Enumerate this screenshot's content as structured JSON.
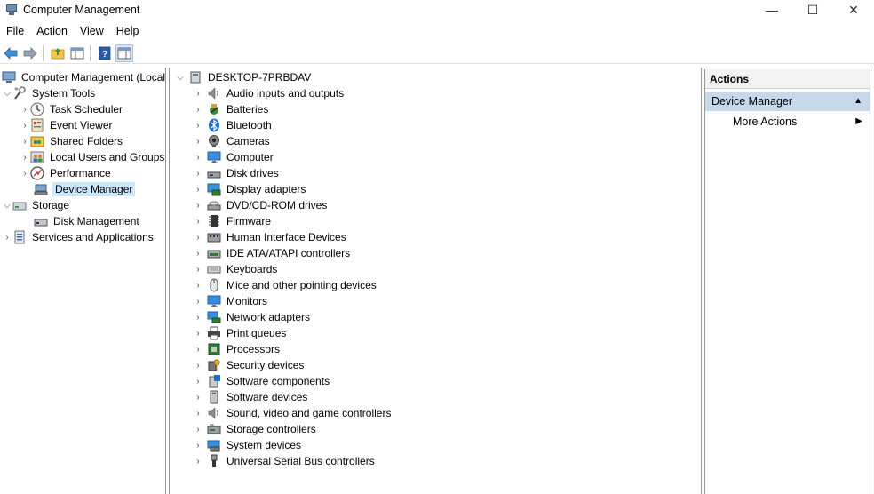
{
  "window": {
    "title": "Computer Management",
    "controls": {
      "minimize": "—",
      "maximize": "☐",
      "close": "✕"
    }
  },
  "menubar": [
    "File",
    "Action",
    "View",
    "Help"
  ],
  "toolbar": {
    "buttons": [
      "back-icon",
      "forward-icon",
      "up-folder-icon",
      "show-hide-tree-icon",
      "help-icon",
      "show-hide-action-pane-icon"
    ]
  },
  "left_tree": {
    "root": "Computer Management (Local",
    "system_tools": "System Tools",
    "items_system": [
      {
        "label": "Task Scheduler",
        "icon": "clock-icon",
        "arrow": true
      },
      {
        "label": "Event Viewer",
        "icon": "event-viewer-icon",
        "arrow": true
      },
      {
        "label": "Shared Folders",
        "icon": "shared-folder-icon",
        "arrow": true
      },
      {
        "label": "Local Users and Groups",
        "icon": "users-icon",
        "arrow": true
      },
      {
        "label": "Performance",
        "icon": "performance-icon",
        "arrow": true
      },
      {
        "label": "Device Manager",
        "icon": "device-manager-icon",
        "arrow": false,
        "selected": true
      }
    ],
    "storage": "Storage",
    "items_storage": [
      {
        "label": "Disk Management",
        "icon": "disk-management-icon"
      }
    ],
    "services": "Services and Applications"
  },
  "device_tree": {
    "root": "DESKTOP-7PRBDAV",
    "categories": [
      {
        "label": "Audio inputs and outputs",
        "icon": "speaker-icon"
      },
      {
        "label": "Batteries",
        "icon": "battery-icon"
      },
      {
        "label": "Bluetooth",
        "icon": "bluetooth-icon"
      },
      {
        "label": "Cameras",
        "icon": "camera-icon"
      },
      {
        "label": "Computer",
        "icon": "monitor-icon"
      },
      {
        "label": "Disk drives",
        "icon": "disk-drive-icon"
      },
      {
        "label": "Display adapters",
        "icon": "display-adapter-icon"
      },
      {
        "label": "DVD/CD-ROM drives",
        "icon": "dvd-drive-icon"
      },
      {
        "label": "Firmware",
        "icon": "firmware-icon"
      },
      {
        "label": "Human Interface Devices",
        "icon": "hid-icon"
      },
      {
        "label": "IDE ATA/ATAPI controllers",
        "icon": "ide-controller-icon"
      },
      {
        "label": "Keyboards",
        "icon": "keyboard-icon"
      },
      {
        "label": "Mice and other pointing devices",
        "icon": "mouse-icon"
      },
      {
        "label": "Monitors",
        "icon": "monitor-icon"
      },
      {
        "label": "Network adapters",
        "icon": "network-adapter-icon"
      },
      {
        "label": "Print queues",
        "icon": "printer-icon"
      },
      {
        "label": "Processors",
        "icon": "processor-icon"
      },
      {
        "label": "Security devices",
        "icon": "security-device-icon"
      },
      {
        "label": "Software components",
        "icon": "software-component-icon"
      },
      {
        "label": "Software devices",
        "icon": "software-device-icon"
      },
      {
        "label": "Sound, video and game controllers",
        "icon": "speaker-icon"
      },
      {
        "label": "Storage controllers",
        "icon": "storage-controller-icon"
      },
      {
        "label": "System devices",
        "icon": "system-device-icon"
      },
      {
        "label": "Universal Serial Bus controllers",
        "icon": "usb-icon"
      }
    ]
  },
  "actions_pane": {
    "header": "Actions",
    "section": "Device Manager",
    "items": [
      "More Actions"
    ]
  },
  "colors": {
    "selection": "#cce8ff",
    "actions_section_bg": "#c6d8ea",
    "pane_border": "#9a9a9a"
  }
}
